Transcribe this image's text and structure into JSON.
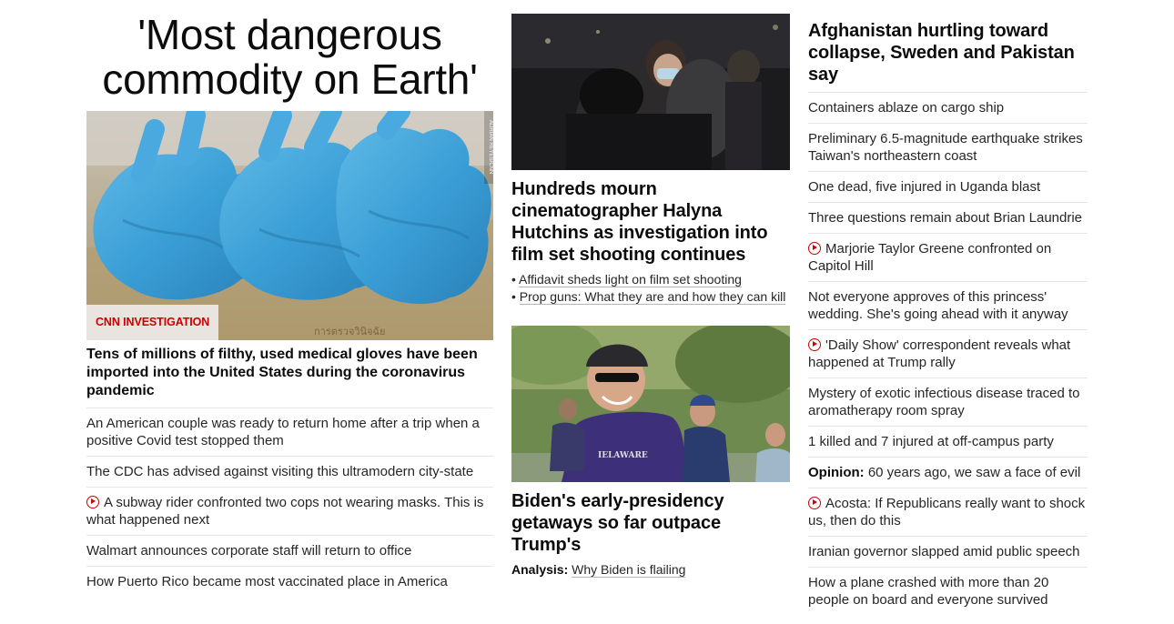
{
  "left": {
    "big_headline": "'Most dangerous commodity on Earth'",
    "image_credit": "ADRIAN REYES/CNN",
    "badge": "CNN INVESTIGATION",
    "lead": "Tens of millions of filthy, used medical gloves have been imported into the United States during the coronavirus pandemic",
    "items": [
      {
        "text": "An American couple was ready to return home after a trip when a positive Covid test stopped them",
        "video": false
      },
      {
        "text": "The CDC has advised against visiting this ultramodern city-state",
        "video": false
      },
      {
        "text": "A subway rider confronted two cops not wearing masks. This is what happened next",
        "video": true
      },
      {
        "text": "Walmart announces corporate staff will return to office",
        "video": false
      },
      {
        "text": "How Puerto Rico became most vaccinated place in America",
        "video": false
      }
    ]
  },
  "mid": {
    "story1": {
      "headline": "Hundreds mourn cinematographer Halyna Hutchins as investigation into film set shooting continues",
      "links": [
        "Affidavit sheds light on film set shooting",
        "Prop guns: What they are and how they can kill"
      ]
    },
    "story2": {
      "headline": "Biden's early-presidency getaways so far outpace Trump's",
      "analysis_label": "Analysis:",
      "analysis_link": "Why Biden is flailing"
    }
  },
  "right": {
    "headline": "Afghanistan hurtling toward collapse, Sweden and Pakistan say",
    "items": [
      {
        "text": "Containers ablaze on cargo ship",
        "video": false,
        "prefix": ""
      },
      {
        "text": "Preliminary 6.5-magnitude earthquake strikes Taiwan's northeastern coast",
        "video": false,
        "prefix": ""
      },
      {
        "text": "One dead, five injured in Uganda blast",
        "video": false,
        "prefix": ""
      },
      {
        "text": "Three questions remain about Brian Laundrie",
        "video": false,
        "prefix": ""
      },
      {
        "text": "Marjorie Taylor Greene confronted on Capitol Hill",
        "video": true,
        "prefix": ""
      },
      {
        "text": "Not everyone approves of this princess' wedding. She's going ahead with it anyway",
        "video": false,
        "prefix": ""
      },
      {
        "text": "'Daily Show' correspondent reveals what happened at Trump rally",
        "video": true,
        "prefix": ""
      },
      {
        "text": "Mystery of exotic infectious disease traced to aromatherapy room spray",
        "video": false,
        "prefix": ""
      },
      {
        "text": "1 killed and 7 injured at off-campus party",
        "video": false,
        "prefix": ""
      },
      {
        "text": "60 years ago, we saw a face of evil",
        "video": false,
        "prefix": "Opinion:"
      },
      {
        "text": "Acosta: If Republicans really want to shock us, then do this",
        "video": true,
        "prefix": ""
      },
      {
        "text": "Iranian governor slapped amid public speech",
        "video": false,
        "prefix": ""
      },
      {
        "text": "How a plane crashed with more than 20 people on board and everyone survived",
        "video": false,
        "prefix": ""
      }
    ]
  },
  "colors": {
    "accent_red": "#cc0000",
    "divider": "#e6e6e6",
    "text": "#0c0c0c"
  }
}
